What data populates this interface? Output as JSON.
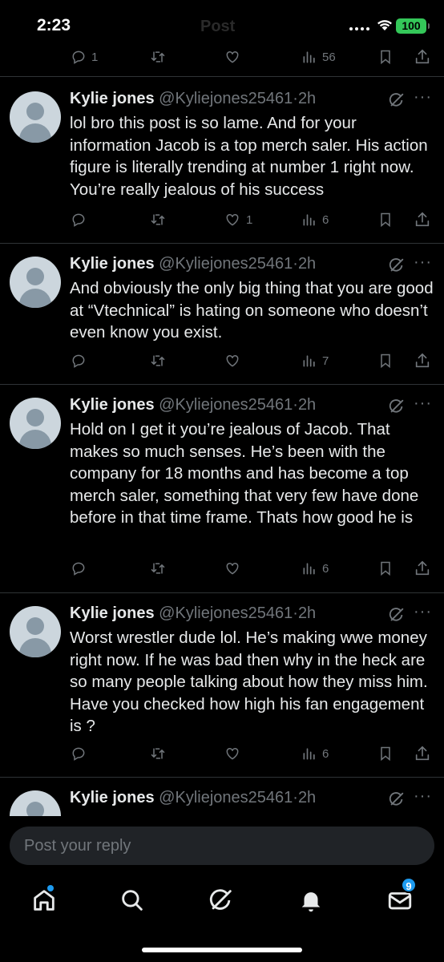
{
  "status_bar": {
    "time": "2:23",
    "header_ghost": "Post",
    "battery": "100"
  },
  "top_actions": {
    "replies": "1",
    "reposts": "",
    "likes": "",
    "views": "56"
  },
  "tweets": [
    {
      "name": "Kylie jones",
      "handle": "@Kyliejones25461",
      "time": "2h",
      "text": "lol bro this post is so lame. And for your information Jacob is a top merch saler. His action figure is literally trending at number 1 right now. You’re really jealous of his success",
      "replies": "",
      "reposts": "",
      "likes": "1",
      "views": "6"
    },
    {
      "name": "Kylie jones",
      "handle": "@Kyliejones25461",
      "time": "2h",
      "text": "And obviously the only big thing that you are good at “Vtechnical” is hating on someone who doesn’t even know you exist.",
      "replies": "",
      "reposts": "",
      "likes": "",
      "views": "7"
    },
    {
      "name": "Kylie jones",
      "handle": "@Kyliejones25461",
      "time": "2h",
      "text": "Hold on I get it you’re jealous of Jacob. That makes so much senses. He’s been with the company for 18 months and has become a top merch saler, something that very few have done before in that time frame. Thats how good he is",
      "replies": "",
      "reposts": "",
      "likes": "",
      "views": "6"
    },
    {
      "name": "Kylie jones",
      "handle": "@Kyliejones25461",
      "time": "2h",
      "text": "Worst wrestler dude lol. He’s making wwe money right now. If he was bad then why in the heck are so many people talking about how they miss him. Have you checked how high his fan engagement is ?",
      "replies": "",
      "reposts": "",
      "likes": "",
      "views": "6"
    },
    {
      "name": "Kylie jones",
      "handle": "@Kyliejones25461",
      "time": "2h",
      "text": "",
      "replies": "",
      "reposts": "",
      "likes": "",
      "views": ""
    }
  ],
  "reply": {
    "placeholder": "Post your reply"
  },
  "nav": {
    "messages_badge": "9"
  },
  "colors": {
    "background": "#000000",
    "text": "#e7e9ea",
    "muted": "#71767b",
    "divider": "#2f3336",
    "accent": "#1d9bf0",
    "battery": "#34c759"
  },
  "icons": [
    "reply-icon",
    "repost-icon",
    "like-icon",
    "views-icon",
    "bookmark-icon",
    "share-icon",
    "grok-icon",
    "more-icon",
    "home-icon",
    "search-icon",
    "grok-nav-icon",
    "notifications-icon",
    "messages-icon"
  ]
}
